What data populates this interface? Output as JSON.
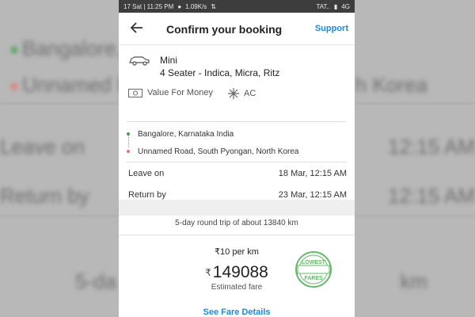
{
  "status_bar": {
    "left": "17 Sat | 11:25 PM",
    "network_speed": "1.09K/s",
    "carrier": "TAT..",
    "right_signal": "4G"
  },
  "header": {
    "title": "Confirm your booking",
    "support_label": "Support"
  },
  "car": {
    "name": "Mini",
    "seats": "4 Seater - Indica, Micra, Ritz",
    "features": [
      {
        "label": "Value For Money",
        "icon": "money-icon"
      },
      {
        "label": "AC",
        "icon": "snowflake-icon"
      }
    ]
  },
  "route": {
    "pickup": "Bangalore, Karnataka India",
    "drop": "Unnamed Road, South Pyongan, North Korea",
    "pickup_color": "#43a047",
    "drop_color": "#e57373"
  },
  "schedule": {
    "leave_label": "Leave on",
    "leave_value": "18 Mar, 12:15 AM",
    "return_label": "Return by",
    "return_value": "23 Mar, 12:15 AM"
  },
  "trip": {
    "summary": "5-day round trip of about 13840 km"
  },
  "fare": {
    "rate": "₹10 per km",
    "currency_symbol": "₹",
    "amount": "149088",
    "label": "Estimated fare",
    "stamp_top": "LOWEST",
    "stamp_bottom": "FARES",
    "stamp_color": "#66bb6a"
  },
  "footer": {
    "link_label": "See Fare Details"
  },
  "accent_color": "#1e88e5"
}
